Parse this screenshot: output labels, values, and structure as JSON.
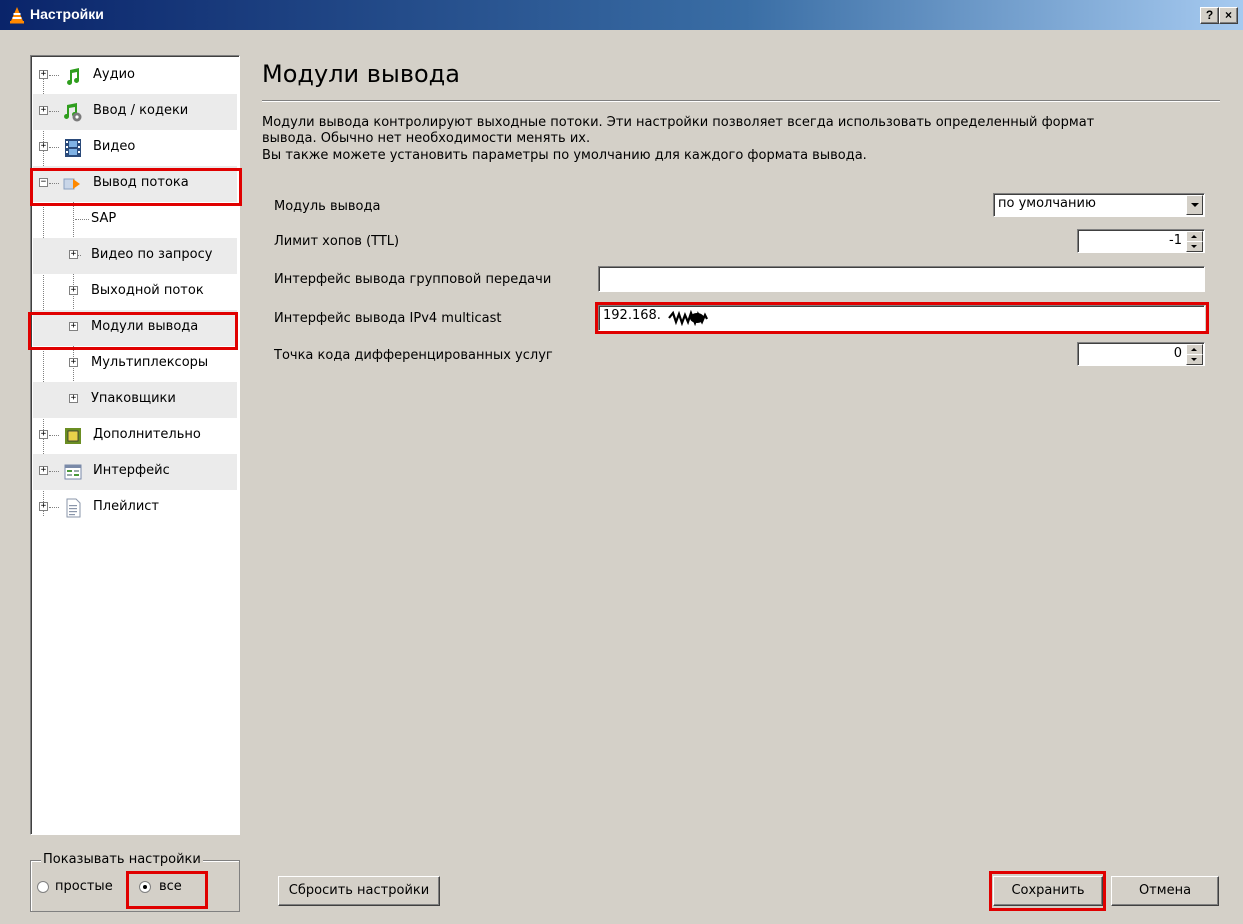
{
  "window": {
    "title": "Настройки",
    "help_label": "?",
    "close_label": "×"
  },
  "sidebar": {
    "items": [
      {
        "label": "Аудио"
      },
      {
        "label": "Ввод / кодеки"
      },
      {
        "label": "Видео"
      },
      {
        "label": "Вывод потока"
      },
      {
        "label": "SAP"
      },
      {
        "label": "Видео по запросу"
      },
      {
        "label": "Выходной поток"
      },
      {
        "label": "Модули вывода"
      },
      {
        "label": "Мультиплексоры"
      },
      {
        "label": "Упаковщики"
      },
      {
        "label": "Дополнительно"
      },
      {
        "label": "Интерфейс"
      },
      {
        "label": "Плейлист"
      }
    ]
  },
  "show_settings": {
    "legend": "Показывать настройки",
    "simple_label": "простые",
    "all_label": "все",
    "selected": "все"
  },
  "main": {
    "title": "Модули вывода",
    "description_lines": [
      "Модули вывода контролируют выходные потоки. Эти настройки позволяет всегда использовать определенный формат",
      "вывода. Обычно нет необходимости менять их.",
      "Вы также можете установить параметры по умолчанию для каждого формата вывода."
    ],
    "fields": {
      "output_module": {
        "label": "Модуль вывода",
        "value": "по умолчанию"
      },
      "ttl": {
        "label": "Лимит хопов (TTL)",
        "value": "-1"
      },
      "multicast_iface": {
        "label": "Интерфейс вывода групповой передачи",
        "value": ""
      },
      "ipv4_multicast": {
        "label": "Интерфейс вывода IPv4 multicast",
        "value": "192.168."
      },
      "dscp": {
        "label": "Точка кода дифференцированных услуг",
        "value": "0"
      }
    }
  },
  "buttons": {
    "reset": "Сбросить настройки",
    "save": "Сохранить",
    "cancel": "Отмена"
  },
  "colors": {
    "highlight": "#e00000",
    "titlebar": "#0a246a",
    "face": "#d4d0c8"
  }
}
